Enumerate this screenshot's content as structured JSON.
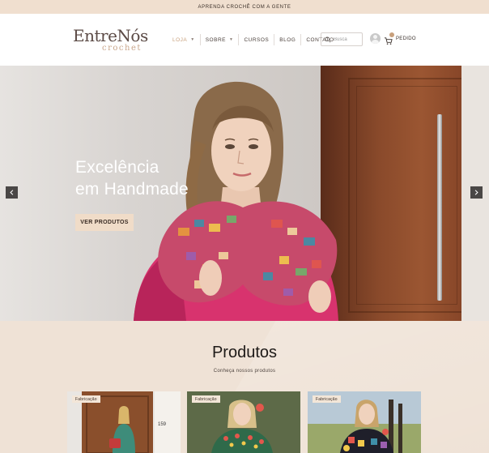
{
  "announcement": "APRENDA CROCHÊ COM A GENTE",
  "logo": {
    "main": "EntreNós",
    "sub": "crochet"
  },
  "nav": [
    {
      "label": "LOJA",
      "has_dropdown": true,
      "active": true
    },
    {
      "label": "SOBRE",
      "has_dropdown": true,
      "active": false
    },
    {
      "label": "CURSOS",
      "has_dropdown": false,
      "active": false
    },
    {
      "label": "BLOG",
      "has_dropdown": false,
      "active": false
    },
    {
      "label": "CONTATO",
      "has_dropdown": false,
      "active": false
    }
  ],
  "search": {
    "placeholder": "Busca"
  },
  "cart": {
    "label": "PEDIDO"
  },
  "hero": {
    "title_line1": "Excelência",
    "title_line2": "em Handmade",
    "button": "VER PRODUTOS"
  },
  "products": {
    "title": "Produtos",
    "subtitle": "Conheça nossos produtos",
    "cards": [
      {
        "badge": "Fabricação"
      },
      {
        "badge": "Fabricação"
      },
      {
        "badge": "Fabricação"
      }
    ]
  },
  "colors": {
    "accent": "#c8a07c",
    "topbar": "#f0dfcf",
    "section_bg": "#efe2d6",
    "button_bg": "#f0dcc8"
  },
  "icons": {
    "search": "search-icon",
    "user": "user-icon",
    "cart": "cart-icon",
    "prev": "chevron-left-icon",
    "next": "chevron-right-icon"
  }
}
